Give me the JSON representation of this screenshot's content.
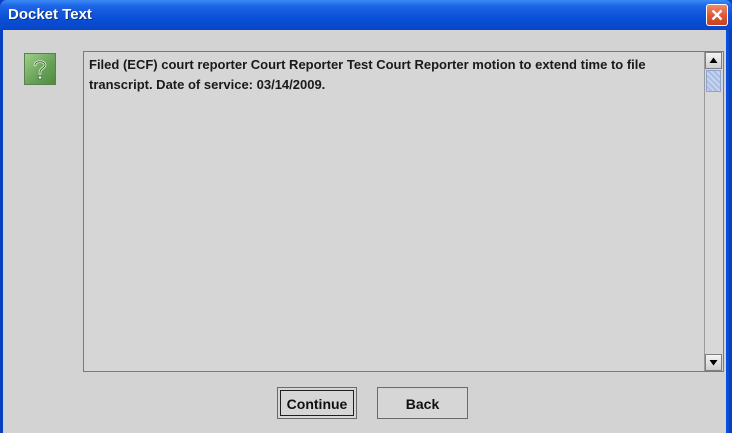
{
  "window": {
    "title": "Docket Text"
  },
  "dialog": {
    "message": "Filed (ECF) court reporter Court Reporter Test Court Reporter motion to extend time to file transcript. Date of service: 03/14/2009.",
    "icon": "question-help-icon"
  },
  "buttons": {
    "continue_label": "Continue",
    "back_label": "Back"
  },
  "colors": {
    "titlebar": "#0a50d8",
    "client_background": "#d3d3d3",
    "close_button": "#e05a38"
  }
}
